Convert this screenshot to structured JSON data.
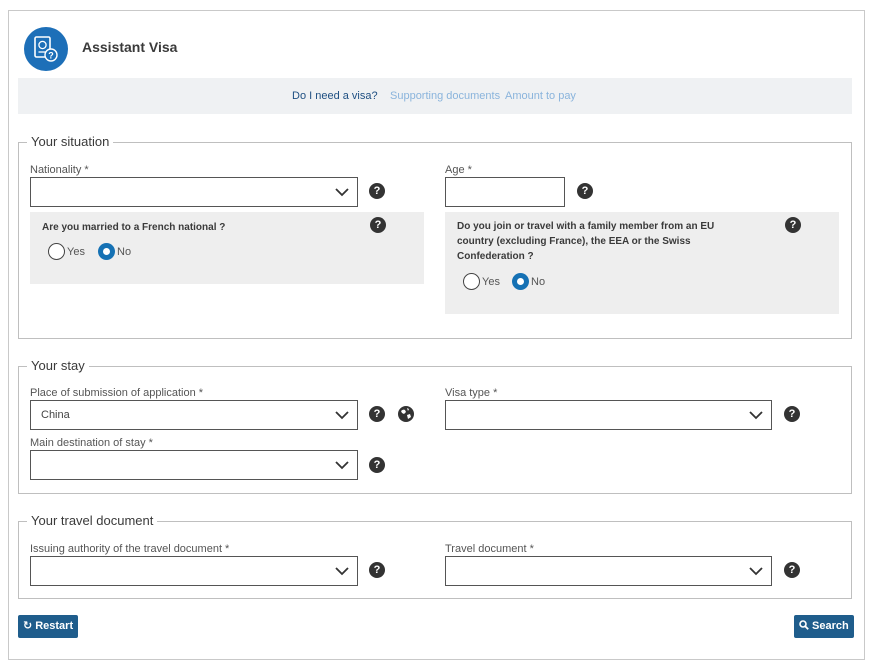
{
  "header": {
    "title": "Assistant Visa",
    "logo_icon": "passport-question-icon"
  },
  "nav": {
    "items": [
      {
        "label": "Do I need a visa?",
        "active": true
      },
      {
        "label": "Supporting documents",
        "active": false
      },
      {
        "label": "Amount to pay",
        "active": false
      }
    ]
  },
  "situation": {
    "legend": "Your situation",
    "nationality": {
      "label": "Nationality *",
      "value": ""
    },
    "age": {
      "label": "Age *",
      "value": ""
    },
    "married": {
      "question": "Are you married to a French national ?",
      "options": [
        "Yes",
        "No"
      ],
      "selected": "No"
    },
    "family": {
      "question_lines": [
        "Do you join or travel with a family member from an EU",
        "country (excluding France), the EEA or the Swiss",
        "Confederation ?"
      ],
      "options": [
        "Yes",
        "No"
      ],
      "selected": "No"
    }
  },
  "stay": {
    "legend": "Your stay",
    "place": {
      "label": "Place of submission of application *",
      "value": "China"
    },
    "visa_type": {
      "label": "Visa type *",
      "value": ""
    },
    "destination": {
      "label": "Main destination of stay *",
      "value": ""
    }
  },
  "travel": {
    "legend": "Your travel document",
    "authority": {
      "label": "Issuing authority of the travel document *",
      "value": ""
    },
    "document": {
      "label": "Travel document *",
      "value": ""
    }
  },
  "buttons": {
    "restart": "Restart",
    "search": "Search"
  },
  "help_glyph": "?",
  "colors": {
    "brand": "#1d6fb8",
    "button": "#1f5d8c",
    "radio_on": "#1571b4",
    "nav_active": "#1e4f82",
    "nav_muted": "#8ab4dc"
  }
}
